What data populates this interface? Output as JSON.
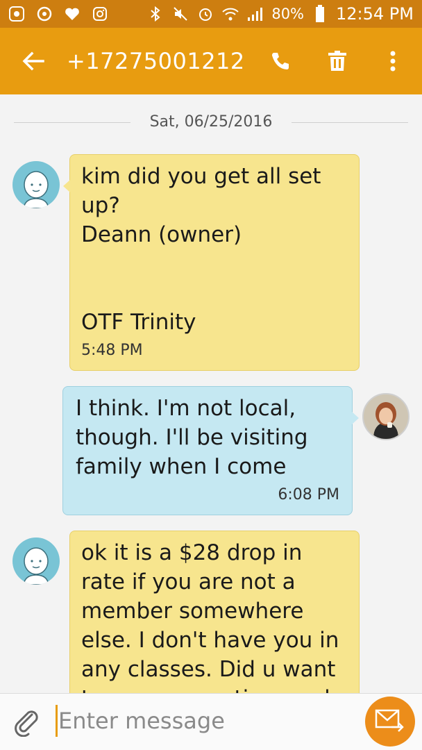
{
  "status_bar": {
    "battery": "80%",
    "time": "12:54 PM"
  },
  "app_bar": {
    "title": "+17275001212",
    "back_icon": "back-arrow-icon",
    "call_icon": "phone-icon",
    "delete_icon": "trash-icon",
    "more_icon": "more-vert-icon"
  },
  "conversation": {
    "date_divider": "Sat, 06/25/2016",
    "messages": [
      {
        "direction": "incoming",
        "text": "kim did you get all set up?\nDeann (owner)\n\n\nOTF Trinity",
        "time": "5:48 PM"
      },
      {
        "direction": "outgoing",
        "text": "I think. I'm not local, though. I'll be visiting family when I come",
        "time": "6:08 PM"
      },
      {
        "direction": "incoming",
        "text": "ok it is a $28 drop in rate if you are not a member somewhere else. I don't have you in any classes. Did u want to come sometime and",
        "time": ""
      }
    ]
  },
  "composer": {
    "placeholder": "Enter message",
    "value": "",
    "attach_icon": "paperclip-icon",
    "send_icon": "send-icon"
  },
  "colors": {
    "status_bar": "#cd7e10",
    "app_bar": "#e89c10",
    "incoming_bubble": "#f7e58e",
    "outgoing_bubble": "#c5e8f2",
    "send_button": "#ec8d1a"
  }
}
